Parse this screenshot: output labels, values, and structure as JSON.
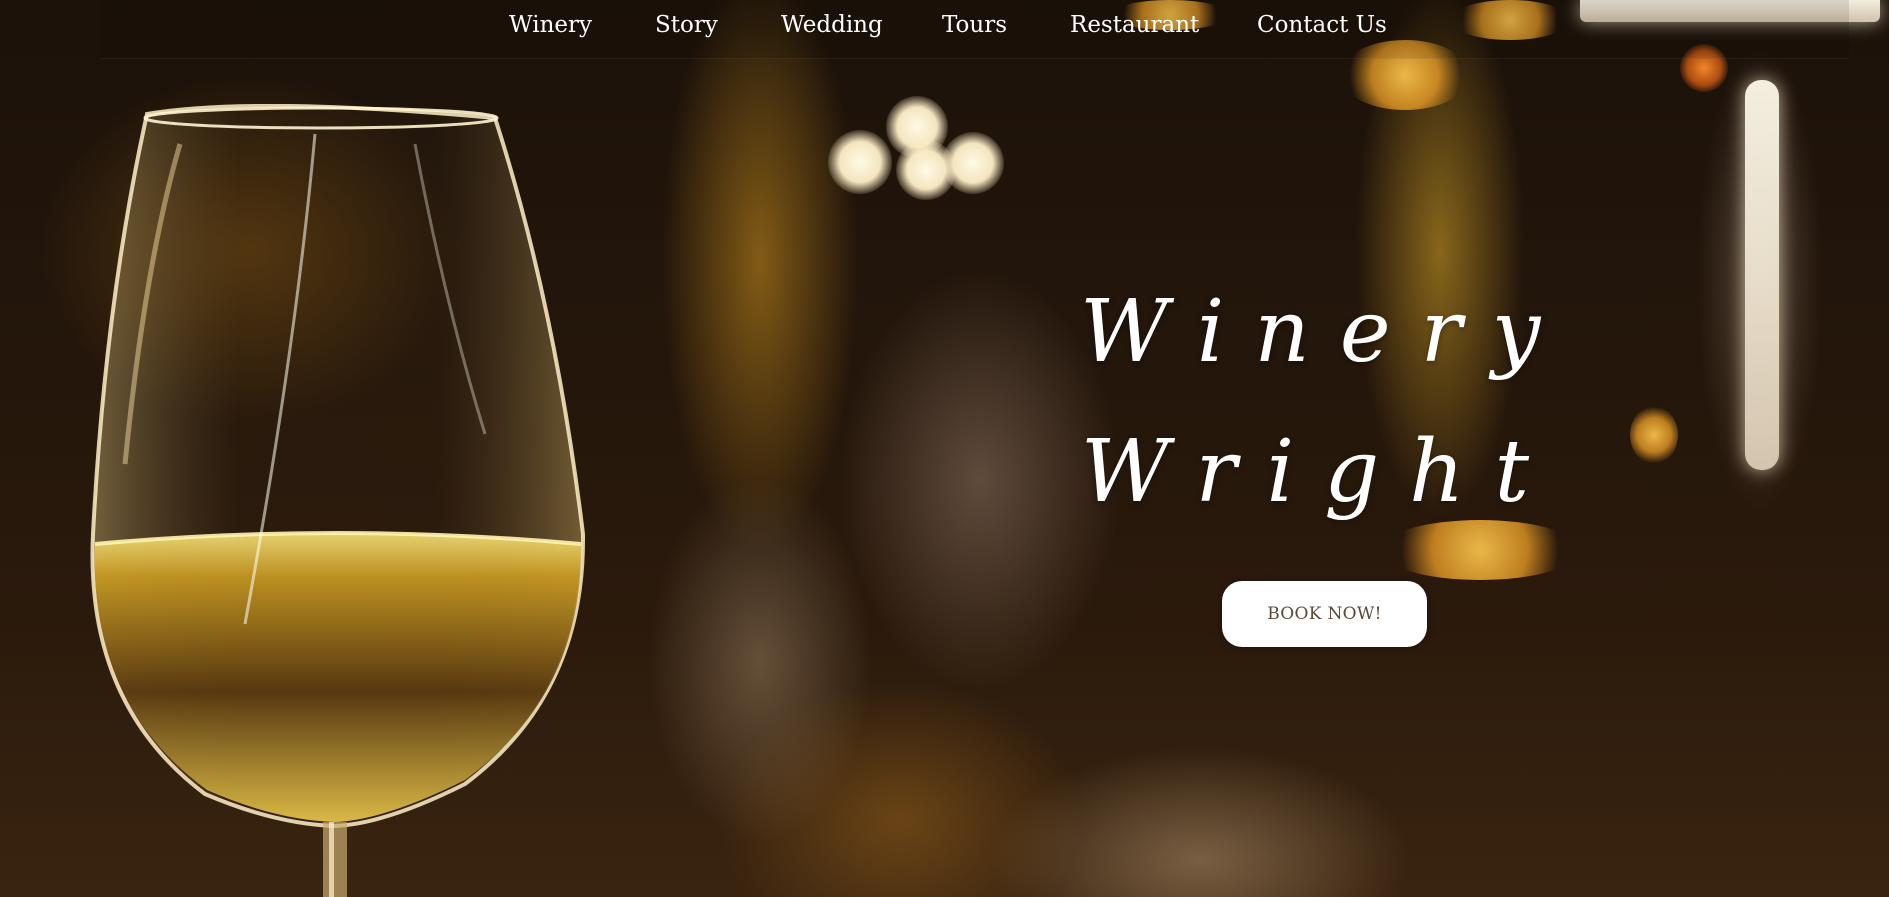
{
  "nav": {
    "items": [
      {
        "label": "Winery"
      },
      {
        "label": "Story"
      },
      {
        "label": "Wedding"
      },
      {
        "label": "Tours"
      },
      {
        "label": "Restaurant"
      },
      {
        "label": "Contact Us"
      }
    ]
  },
  "hero": {
    "title_line1": "Winery",
    "title_line2": "Wright",
    "cta_label": "BOOK NOW!"
  },
  "colors": {
    "nav_text": "#ffffff",
    "title_text": "#ffffff",
    "button_bg": "#ffffff",
    "button_text": "#5a4a3a"
  }
}
